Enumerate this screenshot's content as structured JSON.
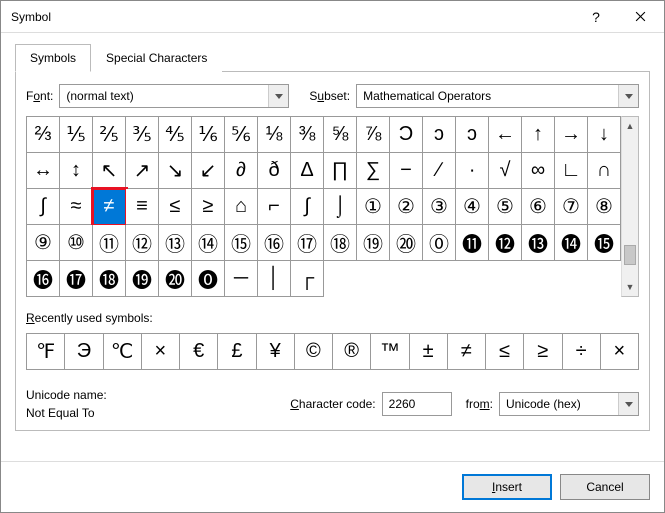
{
  "window": {
    "title": "Symbol"
  },
  "tabs": {
    "symbols": "Symbols",
    "special": "Special Characters"
  },
  "font": {
    "label": "Font:",
    "value": "(normal text)"
  },
  "subset": {
    "label": "Subset:",
    "value": "Mathematical Operators"
  },
  "grid": {
    "cells": [
      "⅔",
      "⅕",
      "⅖",
      "⅗",
      "⅘",
      "⅙",
      "⅚",
      "⅛",
      "⅜",
      "⅝",
      "⅞",
      "Ɔ",
      "ɔ",
      "ɔ",
      "←",
      "↑",
      "→",
      "↓",
      "↔",
      "↕",
      "↖",
      "↗",
      "↘",
      "↙",
      "∂",
      "ð",
      "Δ",
      "∏",
      "∑",
      "−",
      "∕",
      "∙",
      "√",
      "∞",
      "∟",
      "∩",
      "∫",
      "≈",
      "≠",
      "≡",
      "≤",
      "≥",
      "⌂",
      "⌐",
      "∫",
      "⌡",
      "①",
      "②",
      "③",
      "④",
      "⑤",
      "⑥",
      "⑦",
      "⑧",
      "⑨",
      "⑩",
      "⑪",
      "⑫",
      "⑬",
      "⑭",
      "⑮",
      "⑯",
      "⑰",
      "⑱",
      "⑲",
      "⑳",
      "⓪",
      "⓫",
      "⓬",
      "⓭",
      "⓮",
      "⓯",
      "⓰",
      "⓱",
      "⓲",
      "⓳",
      "⓴",
      "⓿",
      "─",
      "│",
      "┌"
    ],
    "selectedIndex": 38
  },
  "recent": {
    "label": "Recently used symbols:",
    "cells": [
      "℉",
      "Э",
      "℃",
      "×",
      "€",
      "£",
      "¥",
      "©",
      "®",
      "™",
      "±",
      "≠",
      "≤",
      "≥",
      "÷",
      "×"
    ]
  },
  "unicode": {
    "nameLabel": "Unicode name:",
    "name": "Not Equal To",
    "codeLabel": "Character code:",
    "code": "2260",
    "fromLabel": "from:",
    "from": "Unicode (hex)"
  },
  "buttons": {
    "insert": "Insert",
    "cancel": "Cancel"
  }
}
